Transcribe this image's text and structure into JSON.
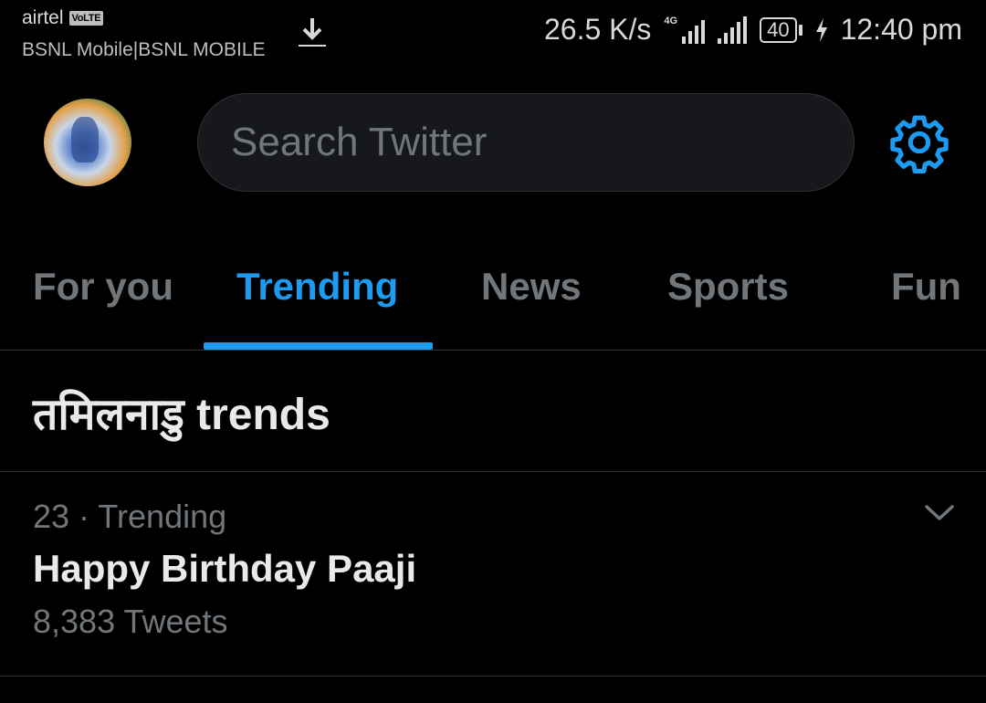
{
  "status_bar": {
    "carrier_primary": "airtel",
    "volte_badge": "VoLTE",
    "carrier_secondary": "BSNL Mobile|BSNL MOBILE",
    "network_speed": "26.5 K/s",
    "network_type": "4G",
    "battery_level": "40",
    "time": "12:40 pm",
    "icons": [
      "download-icon",
      "signal-icon",
      "signal-icon",
      "battery-icon",
      "charging-icon"
    ]
  },
  "header": {
    "avatar": "profile-avatar",
    "search_placeholder": "Search Twitter",
    "settings_icon": "gear-icon",
    "accent_color": "#1d9bf0"
  },
  "tabs": [
    {
      "label": "For you",
      "active": false
    },
    {
      "label": "Trending",
      "active": true
    },
    {
      "label": "News",
      "active": false
    },
    {
      "label": "Sports",
      "active": false
    },
    {
      "label": "Fun",
      "active": false
    }
  ],
  "section": {
    "title": "तमिलनाडु trends"
  },
  "trends": [
    {
      "meta": "23 · Trending",
      "name": "Happy Birthday Paaji",
      "count": "8,383 Tweets"
    }
  ]
}
